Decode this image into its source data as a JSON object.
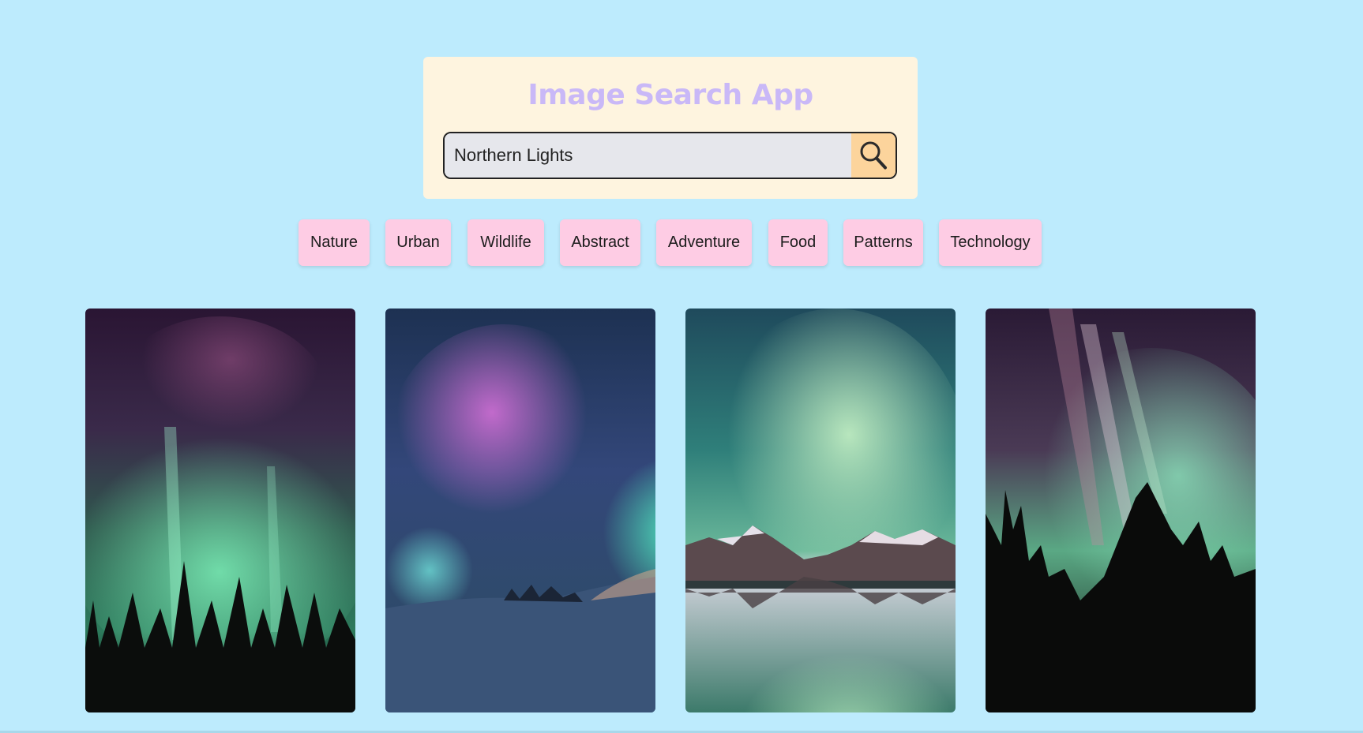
{
  "app": {
    "title": "Image Search App"
  },
  "search": {
    "value": "Northern Lights",
    "button_icon": "search-icon"
  },
  "categories": [
    "Nature",
    "Urban",
    "Wildlife",
    "Abstract",
    "Adventure",
    "Food",
    "Patterns",
    "Technology"
  ],
  "colors": {
    "background": "#bdebfd",
    "card": "#fef4df",
    "title": "#c9b8f7",
    "search_field": "#e6e7ec",
    "search_button": "#fcd49c",
    "chip": "#fecce4"
  }
}
